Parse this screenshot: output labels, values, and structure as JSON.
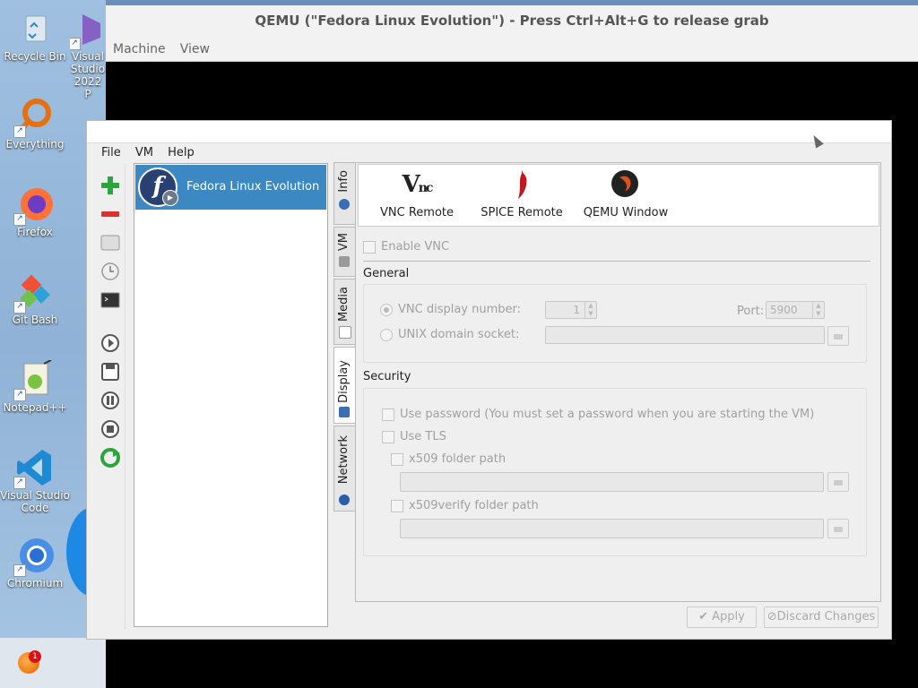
{
  "desktop": {
    "icons": [
      {
        "label": "Recycle Bin"
      },
      {
        "label": "Visual Studio 2022 P"
      },
      {
        "label": "Everything"
      },
      {
        "label": "Firefox"
      },
      {
        "label": "Git Bash"
      },
      {
        "label": "Notepad++"
      },
      {
        "label": "Visual Studio Code"
      },
      {
        "label": "Chromium"
      }
    ],
    "taskbar_badge": "1"
  },
  "qemu": {
    "title": "QEMU (\"Fedora Linux Evolution\") - Press Ctrl+Alt+G to release grab",
    "menu": [
      "Machine",
      "View"
    ]
  },
  "aqemu": {
    "menu": [
      "File",
      "VM",
      "Help"
    ],
    "vm_list": [
      {
        "name": "Fedora Linux Evolution",
        "selected": true
      }
    ],
    "side_tabs": [
      "Info",
      "VM",
      "Media",
      "Display",
      "Network"
    ],
    "active_side_tab": "Display",
    "top_tabs": [
      "VNC Remote",
      "SPICE Remote",
      "QEMU Window"
    ],
    "enable_vnc": {
      "label": "Enable VNC",
      "checked": false
    },
    "general": {
      "title": "General",
      "vnc_display_number": {
        "label": "VNC display number:",
        "value": "1",
        "selected": true
      },
      "port": {
        "label": "Port:",
        "value": "5900"
      },
      "unix_socket": {
        "label": "UNIX domain socket:",
        "value": ""
      }
    },
    "security": {
      "title": "Security",
      "use_password": "Use password (You must set a password when you are starting the VM)",
      "use_tls": "Use TLS",
      "x509_folder": "x509 folder path",
      "x509verify_folder": "x509verify folder path"
    },
    "buttons": {
      "apply": "Apply",
      "discard": "Discard Changes"
    }
  }
}
